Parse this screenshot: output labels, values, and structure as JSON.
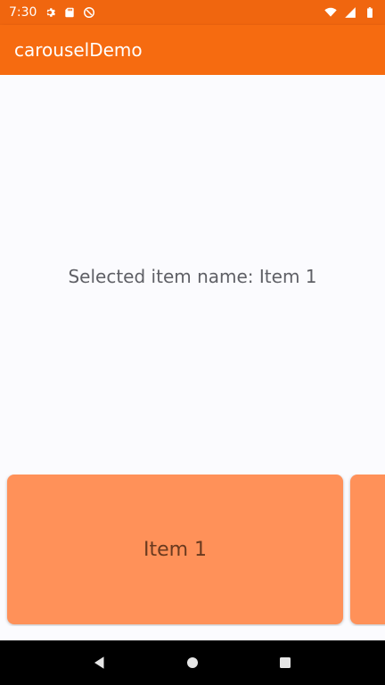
{
  "status_bar": {
    "time": "7:30",
    "left_icons": [
      "settings-icon",
      "sd-card-icon",
      "do-not-disturb-icon"
    ],
    "right_icons": [
      "wifi-icon",
      "cellular-signal-icon",
      "battery-icon"
    ]
  },
  "app_bar": {
    "title": "carouselDemo",
    "color": "#f66b10"
  },
  "main": {
    "selected_text": "Selected item name: Item 1"
  },
  "carousel": {
    "items": [
      {
        "label": "Item 1"
      },
      {
        "label": ""
      }
    ],
    "card_color": "#ff9159"
  },
  "nav_bar": {
    "buttons": [
      "back-icon",
      "home-icon",
      "recents-icon"
    ]
  }
}
